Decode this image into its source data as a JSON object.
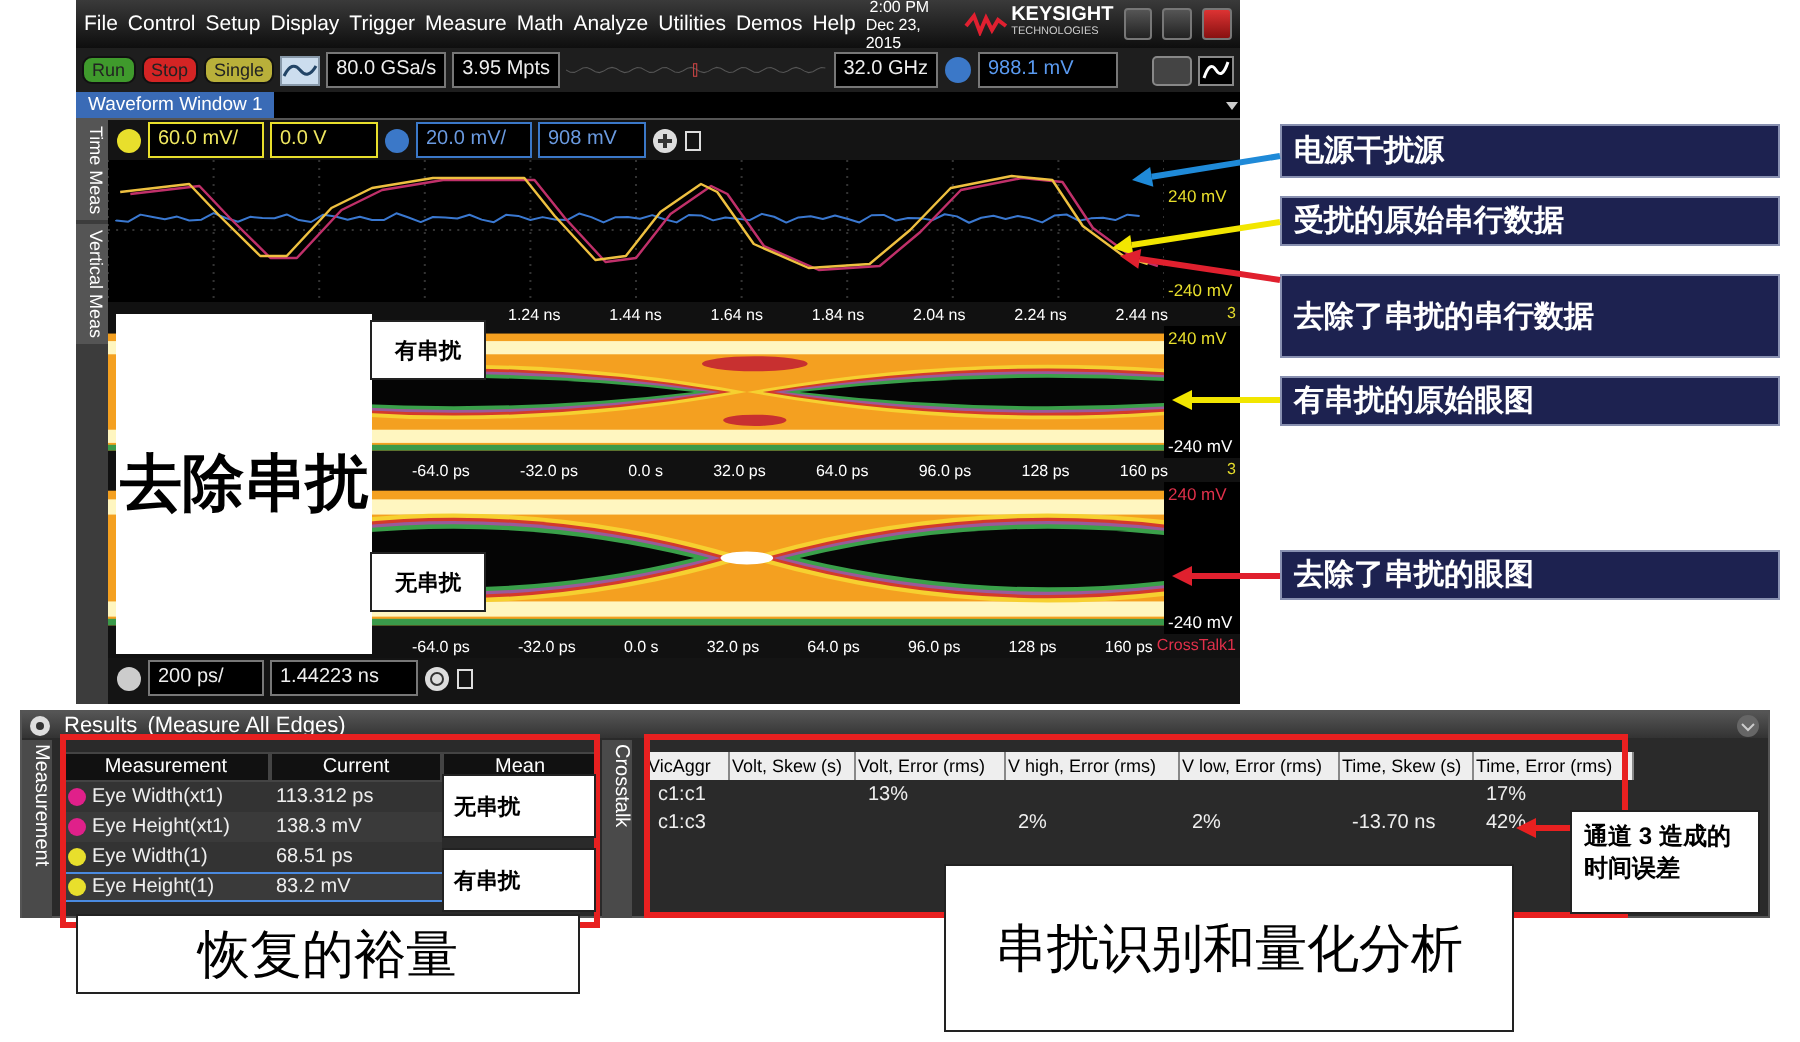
{
  "window": {
    "menu": [
      "File",
      "Control",
      "Setup",
      "Display",
      "Trigger",
      "Measure",
      "Math",
      "Analyze",
      "Utilities",
      "Demos",
      "Help"
    ],
    "clock": {
      "time": "2:00 PM",
      "date": "Dec 23, 2015"
    },
    "logo": {
      "name": "KEYSIGHT",
      "tagline": "TECHNOLOGIES"
    }
  },
  "toolbar": {
    "buttons": [
      {
        "label": "Run",
        "color": "#3f9a2c"
      },
      {
        "label": "Stop",
        "color": "#d42424"
      },
      {
        "label": "Single",
        "color": "#b9b03a"
      }
    ],
    "sample_rate": "80.0 GSa/s",
    "memory_depth": "3.95 Mpts",
    "bandwidth": "32.0 GHz",
    "trigger_level": "988.1 mV"
  },
  "tabs": [
    {
      "label": "Waveform Window 1",
      "selected": true
    }
  ],
  "side_tabs": [
    "Time Meas",
    "Vertical Meas"
  ],
  "channels": [
    {
      "scale": "60.0 mV/",
      "offset": "0.0 V",
      "color": "#e8df2c"
    },
    {
      "scale": "20.0 mV/",
      "offset": "908 mV",
      "color": "#3b78c8"
    }
  ],
  "waveform": {
    "y_top": "240 mV",
    "y_bottom": "-240 mV",
    "x_ticks": [
      "1.24 ns",
      "1.44 ns",
      "1.64 ns",
      "1.84 ns",
      "2.04 ns",
      "2.24 ns",
      "2.44 ns"
    ],
    "tag": "3"
  },
  "eye_diagrams": [
    {
      "kind": "with-crosstalk",
      "y_top": "240 mV",
      "y_bottom": "-240 mV",
      "x_ticks": [
        "-64.0 ps",
        "-32.0 ps",
        "0.0 s",
        "32.0 ps",
        "64.0 ps",
        "96.0 ps",
        "128 ps",
        "160 ps"
      ],
      "tag": "3",
      "color": "#e8df2c"
    },
    {
      "kind": "crosstalk-removed",
      "y_top": "240 mV",
      "y_bottom": "-240 mV",
      "x_ticks": [
        "-64.0 ps",
        "-32.0 ps",
        "0.0 s",
        "32.0 ps",
        "64.0 ps",
        "96.0 ps",
        "128 ps",
        "160 ps"
      ],
      "tag": "CrossTalk1",
      "color": "#e0304a"
    }
  ],
  "timebase": {
    "scale": "200 ps/",
    "position": "1.44223 ns"
  },
  "results": {
    "title": "Results",
    "subtitle": "(Measure All Edges)",
    "measurement_tab": "Measurement",
    "columns": [
      "Measurement",
      "Current",
      "Mean"
    ],
    "rows": [
      {
        "name": "Eye Width(xt1)",
        "current": "113.312 ps",
        "color": "#e0208a",
        "selected": false
      },
      {
        "name": "Eye Height(xt1)",
        "current": "138.3 mV",
        "color": "#e0208a",
        "selected": false
      },
      {
        "name": "Eye Width(1)",
        "current": "68.51 ps",
        "color": "#e8df2c",
        "selected": false
      },
      {
        "name": "Eye Height(1)",
        "current": "83.2 mV",
        "color": "#e8df2c",
        "selected": true
      }
    ],
    "crosstalk_tab": "Crosstalk",
    "crosstalk_columns": [
      "VicAggr",
      "Volt, Skew (s)",
      "Volt, Error (rms)",
      "V high, Error (rms)",
      "V low, Error (rms)",
      "Time, Skew (s)",
      "Time, Error (rms)"
    ],
    "crosstalk_rows": [
      {
        "cells": [
          "c1:c1",
          null,
          "13%",
          null,
          null,
          null,
          "17%"
        ]
      },
      {
        "cells": [
          "c1:c3",
          null,
          null,
          "2%",
          "2%",
          "-13.70 ns",
          "42%"
        ]
      }
    ]
  },
  "annotations": {
    "main_label": "去除串扰",
    "eye_labels": [
      "有串扰",
      "无串扰"
    ],
    "mean_labels": [
      "无串扰",
      "有串扰"
    ],
    "margin_label": "恢复的裕量",
    "analysis_label": "串扰识别和量化分析",
    "note": "通道 **3** 造成的时间误差",
    "callouts": [
      {
        "text": "电源干扰源",
        "color": "#1f8ad8"
      },
      {
        "text": "受扰的原始串行数据",
        "color": "#f2e600"
      },
      {
        "text": "去除了串扰的串行数据",
        "color": "#e0202e"
      },
      {
        "text": "有串扰的原始眼图",
        "color": "#f2e600"
      },
      {
        "text": "去除了串扰的眼图",
        "color": "#e0202e"
      }
    ]
  }
}
